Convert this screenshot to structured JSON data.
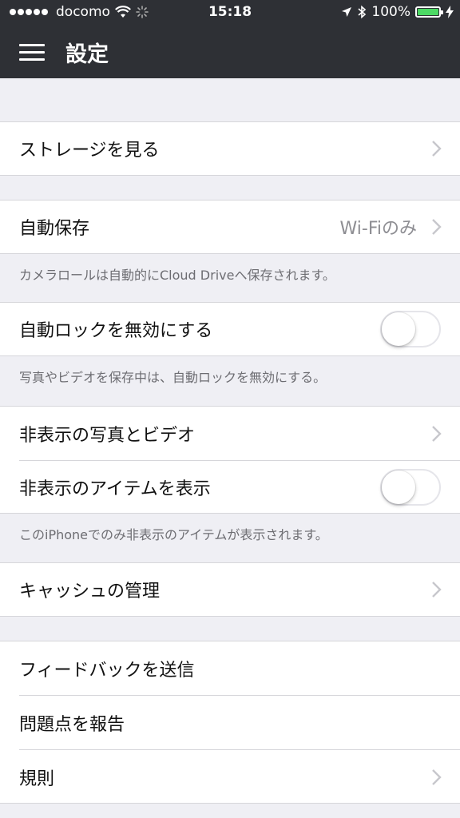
{
  "status_bar": {
    "carrier": "docomo",
    "time": "15:18",
    "battery": "100%",
    "battery_level": 1.0,
    "accent_color": "#4cd964"
  },
  "nav": {
    "title": "設定",
    "menu_icon": "hamburger-menu-icon"
  },
  "sections": {
    "storage": {
      "label": "ストレージを見る"
    },
    "auto_save": {
      "label": "自動保存",
      "value": "Wi-Fiのみ",
      "footnote": "カメラロールは自動的にCloud Driveへ保存されます。"
    },
    "auto_lock": {
      "label": "自動ロックを無効にする",
      "on": false,
      "footnote": "写真やビデオを保存中は、自動ロックを無効にする。"
    },
    "hidden_media": {
      "label": "非表示の写真とビデオ"
    },
    "show_hidden": {
      "label": "非表示のアイテムを表示",
      "on": false,
      "footnote": "このiPhoneでのみ非表示のアイテムが表示されます。"
    },
    "cache": {
      "label": "キャッシュの管理"
    },
    "feedback": {
      "label": "フィードバックを送信"
    },
    "report": {
      "label": "問題点を報告"
    },
    "terms": {
      "label": "規則"
    }
  }
}
